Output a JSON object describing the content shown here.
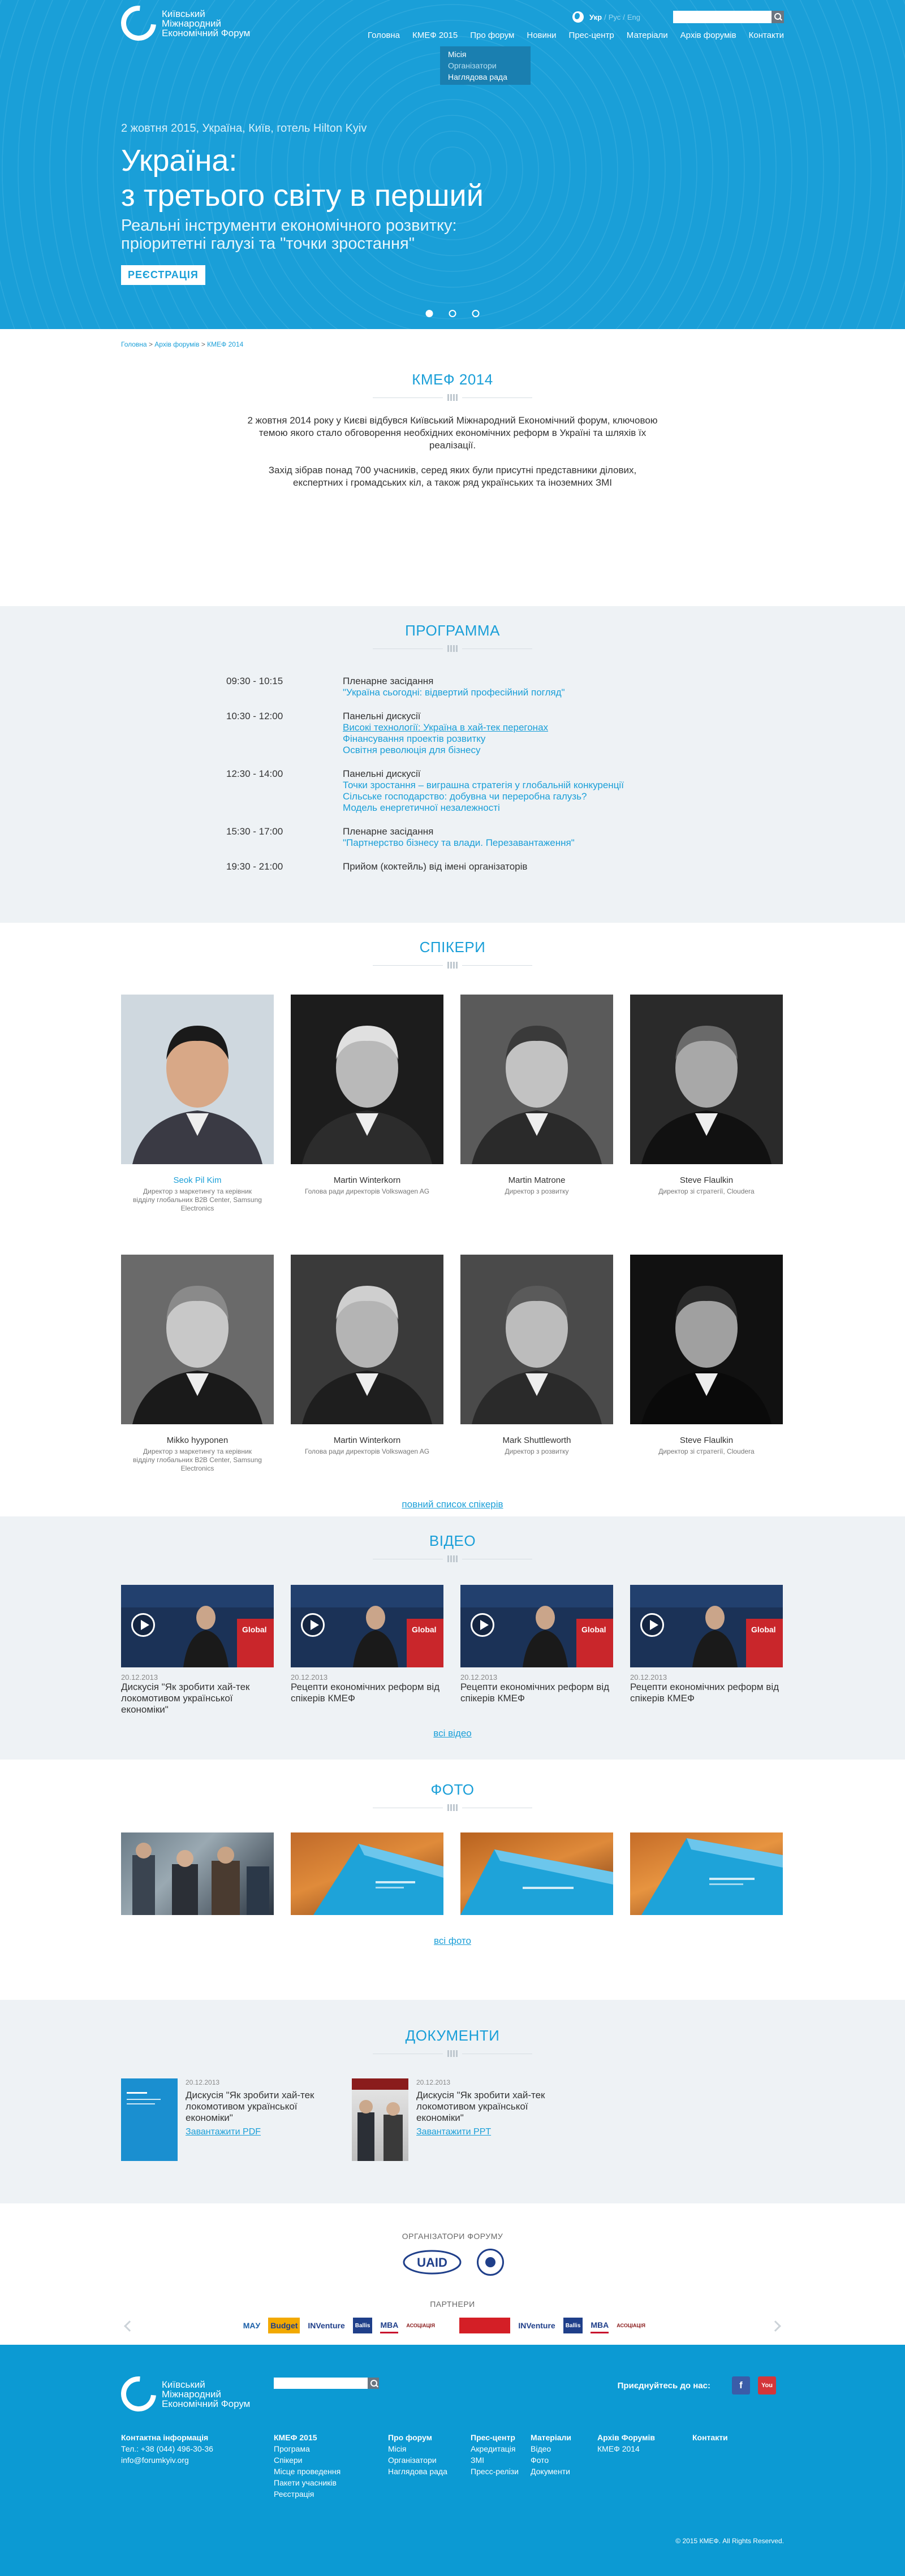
{
  "header": {
    "logo_text": "Київський Міжнародний Економічний Форум",
    "languages": [
      {
        "label": "Укр",
        "active": true
      },
      {
        "label": "Рус",
        "active": false
      },
      {
        "label": "Eng",
        "active": false
      }
    ],
    "lang_sep": "/",
    "search_placeholder": "",
    "nav": [
      "Головна",
      "КМЕФ 2015",
      "Про форум",
      "Новини",
      "Прес-центр",
      "Матеріали",
      "Архів форумів",
      "Контакти"
    ],
    "dropdown": [
      "Місія",
      "Організатори",
      "Наглядова рада"
    ]
  },
  "hero": {
    "date": "2 жовтня 2015, Україна, Київ, готель Hilton Kyiv",
    "title_line1": "Україна:",
    "title_line2": "з третього світу в перший",
    "subtitle_line1": "Реальні інструменти економічного розвитку:",
    "subtitle_line2": "пріоритетні галузі та \"точки зростання\"",
    "register_label": "РЕЄСТРАЦІЯ",
    "slide_count": 3,
    "active_slide": 1
  },
  "breadcrumb": [
    "Головна",
    "Архів форумів",
    "КМЕФ 2014"
  ],
  "breadcrumb_sep": ">",
  "about": {
    "title": "КМЕФ 2014",
    "p1": "2 жовтня 2014 року у Києві відбувся Київський Міжнародний Економічний форум, ключовою темою якого стало обговорення необхідних економічних реформ в Україні та шляхів їх реалізації.",
    "p2": "Захід зібрав понад 700 учасників, серед яких були присутні представники ділових, експертних і громадських кіл, а також ряд українських та іноземних ЗМІ"
  },
  "program": {
    "title": "ПРОГРАММА",
    "rows": [
      {
        "time": "09:30 - 10:15",
        "head": "Пленарне засідання",
        "links": [
          "\"Україна сьогодні: відвертий професійний погляд\""
        ],
        "underline": [
          false
        ]
      },
      {
        "time": "10:30 - 12:00",
        "head": "Панельні дискусії",
        "links": [
          "Високі технології: Україна в хай-тек перегонах",
          "Фінансування проектів розвитку",
          "Освітня революція для бізнесу"
        ],
        "underline": [
          true,
          false,
          false
        ]
      },
      {
        "time": "12:30 - 14:00",
        "head": "Панельні дискусії",
        "links": [
          "Точки зростання – виграшна стратегія у глобальній конкуренції",
          "Сільське господарство: добувна чи переробна галузь?",
          "Модель енергетичної незалежності"
        ],
        "underline": [
          false,
          false,
          false
        ]
      },
      {
        "time": "15:30 - 17:00",
        "head": "Пленарне засідання",
        "links": [
          "\"Партнерство бізнесу та влади. Перезавантаження\""
        ],
        "underline": [
          false
        ]
      },
      {
        "time": "19:30 - 21:00",
        "head": "Прийом (коктейль) від імені організаторів",
        "links": [],
        "underline": []
      }
    ]
  },
  "speakers": {
    "title": "СПІКЕРИ",
    "items": [
      {
        "name": "Seok Pil Kim",
        "role": "Директор з маркетингу та керівник відділу глобальних B2B Center, Samsung Electronics",
        "highlight": true,
        "color": true
      },
      {
        "name": "Martin Winterkorn",
        "role": "Голова ради директорів Volkswagen AG",
        "highlight": false,
        "color": false
      },
      {
        "name": "Martin Matrone",
        "role": "Директор з розвитку",
        "highlight": false,
        "color": false
      },
      {
        "name": "Steve Flaulkin",
        "role": "Директор зі стратегії, Cloudera",
        "highlight": false,
        "color": false
      },
      {
        "name": "Mikko hyyponen",
        "role": "Директор з маркетингу та керівник відділу глобальних B2B Center, Samsung Electronics",
        "highlight": false,
        "color": false
      },
      {
        "name": "Martin Winterkorn",
        "role": "Голова ради директорів Volkswagen AG",
        "highlight": false,
        "color": false
      },
      {
        "name": "Mark Shuttleworth",
        "role": "Директор з розвитку",
        "highlight": false,
        "color": false
      },
      {
        "name": "Steve Flaulkin",
        "role": "Директор зі стратегії, Cloudera",
        "highlight": false,
        "color": false
      }
    ],
    "more_label": "повний список спікерів"
  },
  "video": {
    "title": "ВІДЕО",
    "items": [
      {
        "date": "20.12.2013",
        "title": "Дискусія \"Як зробити хай-тек локомотивом української економіки\""
      },
      {
        "date": "20.12.2013",
        "title": "Рецепти економічних реформ від спікерів КМЕФ"
      },
      {
        "date": "20.12.2013",
        "title": "Рецепти економічних реформ від спікерів КМЕФ"
      },
      {
        "date": "20.12.2013",
        "title": "Рецепти економічних реформ від спікерів КМЕФ"
      }
    ],
    "banner_text": "Global",
    "more_label": "всі відео"
  },
  "photo": {
    "title": "ФОТО",
    "count": 4,
    "more_label": "всі фото"
  },
  "documents": {
    "title": "ДОКУМЕНТИ",
    "items": [
      {
        "date": "20.12.2013",
        "title": "Дискусія \"Як зробити хай-тек локомотивом української економіки\"",
        "download": "Завантажити PDF"
      },
      {
        "date": "20.12.2013",
        "title": "Дискусія \"Як зробити хай-тек локомотивом української економіки\"",
        "download": "Завантажити PPT"
      }
    ]
  },
  "organizers": {
    "title": "ОРГАНІЗАТОРИ ФОРУМУ",
    "logos": [
      "UAID"
    ],
    "partners_title": "ПАРТНЕРИ",
    "partners": [
      "MAУ",
      "Budget",
      "INVenture",
      "Ballis",
      "MBA",
      "АСОЦІАЦІЯ",
      "",
      "INVenture",
      "Ballis",
      "MBA",
      "АСОЦІАЦІЯ"
    ]
  },
  "footer": {
    "logo_text": "Київський Міжнародний Економічний Форум",
    "join_label": "Приєднуйтесь до нас:",
    "social": [
      "f",
      "You"
    ],
    "contacts": {
      "title": "Контактна інформація",
      "lines": [
        "Тел.: +38 (044) 496-30-36",
        "info@forumkyiv.org"
      ]
    },
    "columns": [
      {
        "title": "КМЕФ 2015",
        "links": [
          "Програма",
          "Спікери",
          "Місце проведення",
          "Пакети учасників",
          "Реєстрація"
        ]
      },
      {
        "title": "Про форум",
        "links": [
          "Місія",
          "Організатори",
          "Наглядова рада"
        ]
      },
      {
        "title": "Прес-центр",
        "links": [
          "Акредитація ЗМІ",
          "Пресс-релізи"
        ]
      },
      {
        "title": "Матеріали",
        "links": [
          "Відео",
          "Фото",
          "Документи"
        ]
      },
      {
        "title": "Архів Форумів",
        "links": [
          "КМЕФ 2014"
        ]
      },
      {
        "title": "Контакти",
        "links": []
      }
    ],
    "copyright": "© 2015 КМЕФ. All Rights Reserved."
  },
  "colors": {
    "brand": "#1a9fd8",
    "footer": "#0c9ad3",
    "section_bg": "#eef2f5"
  }
}
